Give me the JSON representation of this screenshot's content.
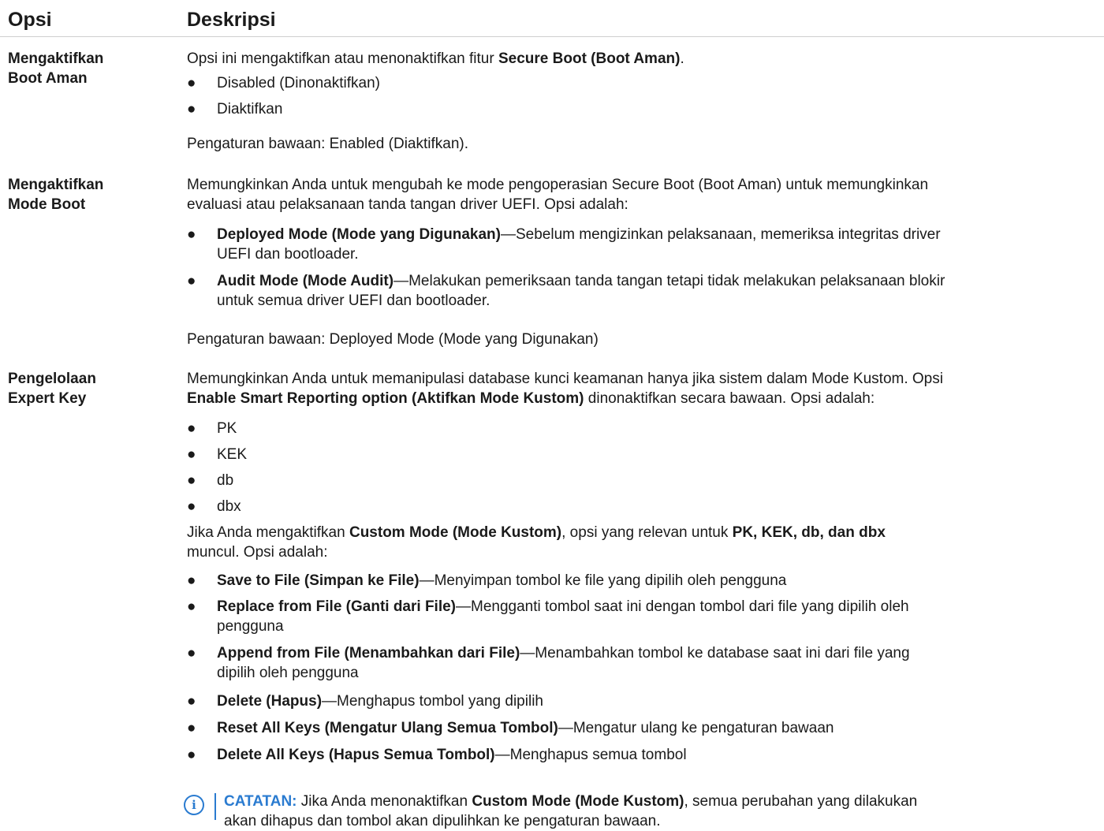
{
  "header": {
    "option": "Opsi",
    "description": "Deskripsi"
  },
  "rows": [
    {
      "label": [
        "Mengaktifkan",
        "Boot Aman"
      ],
      "intro_pre": "Opsi ini mengaktifkan atau menonaktifkan fitur ",
      "intro_bold": "Secure Boot (Boot Aman)",
      "intro_post": ".",
      "bullets": [
        "Disabled (Dinonaktifkan)",
        "Diaktifkan"
      ],
      "default": "Pengaturan bawaan: Enabled (Diaktifkan)."
    },
    {
      "label": [
        "Mengaktifkan",
        "Mode Boot"
      ],
      "intro_line1": "Memungkinkan Anda untuk mengubah ke mode pengoperasian Secure Boot (Boot Aman) untuk memungkinkan",
      "intro_line2": "evaluasi atau pelaksanaan tanda tangan driver UEFI. Opsi adalah:",
      "bullets": [
        {
          "bold": "Deployed Mode (Mode yang Digunakan)",
          "text": "—Sebelum mengizinkan pelaksanaan, memeriksa integritas driver",
          "cont": "UEFI dan bootloader."
        },
        {
          "bold": "Audit Mode (Mode Audit)",
          "text": "—Melakukan pemeriksaan tanda tangan tetapi tidak melakukan pelaksanaan blokir",
          "cont": "untuk semua driver UEFI dan bootloader."
        }
      ],
      "default": "Pengaturan bawaan: Deployed Mode (Mode yang Digunakan)"
    },
    {
      "label": [
        "Pengelolaan",
        "Expert Key"
      ],
      "intro_line1": "Memungkinkan Anda untuk memanipulasi database kunci keamanan hanya jika sistem dalam Mode Kustom. Opsi",
      "intro_line2_bold": "Enable Smart Reporting option (Aktifkan Mode Kustom)",
      "intro_line2_post": " dinonaktifkan secara bawaan. Opsi adalah:",
      "keys": [
        "PK",
        "KEK",
        "db",
        "dbx"
      ],
      "custom_pre": "Jika Anda mengaktifkan ",
      "custom_bold1": "Custom Mode (Mode Kustom)",
      "custom_mid": ", opsi yang relevan untuk ",
      "custom_bold2": "PK, KEK, db, dan dbx",
      "custom_line2": "muncul. Opsi adalah:",
      "actions": [
        {
          "bold": "Save to File (Simpan ke File)",
          "text": "—Menyimpan tombol ke file yang dipilih oleh pengguna",
          "cont": ""
        },
        {
          "bold": "Replace from File (Ganti dari File)",
          "text": "—Mengganti tombol saat ini dengan tombol dari file yang dipilih oleh",
          "cont": "pengguna"
        },
        {
          "bold": "Append from File (Menambahkan dari File)",
          "text": "—Menambahkan tombol ke database saat ini dari file yang",
          "cont": "dipilih oleh pengguna"
        },
        {
          "bold": "Delete (Hapus)",
          "text": "—Menghapus tombol yang dipilih",
          "cont": ""
        },
        {
          "bold": "Reset All Keys (Mengatur Ulang Semua Tombol)",
          "text": "—Mengatur ulang ke pengaturan bawaan",
          "cont": ""
        },
        {
          "bold": "Delete All Keys (Hapus Semua Tombol)",
          "text": "—Menghapus semua tombol",
          "cont": ""
        }
      ],
      "note": {
        "icon": "info-icon",
        "label": "CATATAN:",
        "pre": " Jika Anda menonaktifkan ",
        "bold": "Custom Mode (Mode Kustom)",
        "post": ", semua perubahan yang dilakukan",
        "line2": "akan dihapus dan tombol akan dipulihkan ke pengaturan bawaan."
      }
    }
  ],
  "bullet_glyph": "●",
  "accent_color": "#2a7bd0"
}
